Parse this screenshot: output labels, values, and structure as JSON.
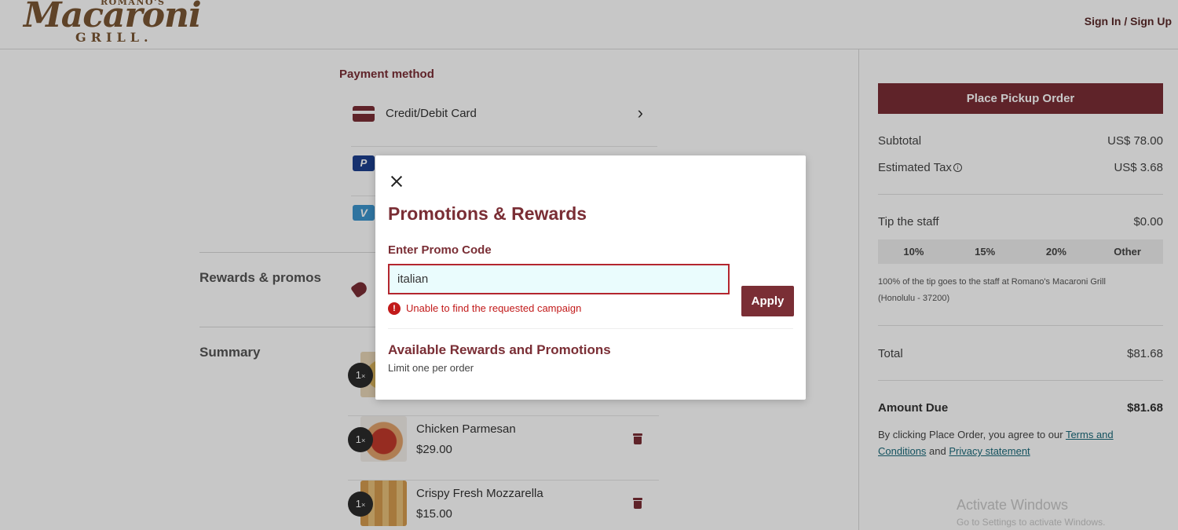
{
  "header": {
    "logo": {
      "top": "ROMANO'S",
      "main": "Macaroni",
      "bottom": "GRILL."
    },
    "signin_label": "Sign In / Sign Up"
  },
  "payment": {
    "title": "Payment method",
    "methods": [
      {
        "label": "Credit/Debit Card",
        "icon": "credit-card-icon"
      },
      {
        "label": "",
        "icon": "paypal-icon",
        "glyph": "P"
      },
      {
        "label": "",
        "icon": "venmo-icon",
        "glyph": "V"
      }
    ]
  },
  "rewards": {
    "title": "Rewards & promos"
  },
  "summary": {
    "title": "Summary",
    "items": [
      {
        "qty": "1",
        "name": "",
        "price": ""
      },
      {
        "qty": "1",
        "name": "Chicken Parmesan",
        "price": "$29.00"
      },
      {
        "qty": "1",
        "name": "Crispy Fresh Mozzarella",
        "price": "$15.00"
      }
    ]
  },
  "order": {
    "place_label": "Place Pickup Order",
    "subtotal_label": "Subtotal",
    "subtotal_value": "US$ 78.00",
    "tax_label": "Estimated Tax",
    "tax_value": "US$ 3.68",
    "tip_label": "Tip the staff",
    "tip_value": "$0.00",
    "tip_options": [
      "10%",
      "15%",
      "20%",
      "Other"
    ],
    "tip_note": "100% of the tip goes to the staff at Romano's Macaroni Grill (Honolulu - 37200)",
    "total_label": "Total",
    "total_value": "$81.68",
    "due_label": "Amount Due",
    "due_value": "$81.68",
    "agree_prefix": "By clicking Place Order, you agree to our ",
    "terms_link": "Terms and Conditions",
    "agree_mid": " and ",
    "privacy_link": "Privacy statement"
  },
  "modal": {
    "title": "Promotions & Rewards",
    "promo_label": "Enter Promo Code",
    "promo_value": "italian",
    "error": "Unable to find the requested campaign",
    "apply_label": "Apply",
    "available_title": "Available Rewards and Promotions",
    "limit_text": "Limit one per order"
  },
  "watermark": {
    "title": "Activate Windows",
    "sub": "Go to Settings to activate Windows."
  },
  "colors": {
    "brand": "#7a2e35",
    "error": "#c21a1a",
    "link": "#1a6a7a"
  }
}
